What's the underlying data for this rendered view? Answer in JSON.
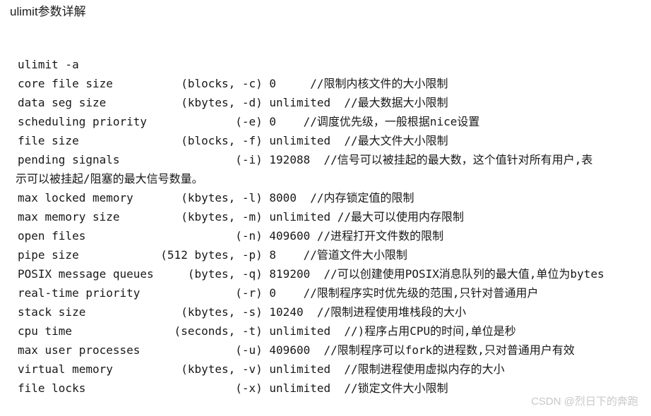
{
  "page": {
    "title": "ulimit参数详解",
    "background_color": "#ffffff",
    "text_color": "#181818"
  },
  "code_block": {
    "command": "ulimit -a",
    "lines": [
      "ulimit -a",
      "core file size          (blocks, -c) 0     //限制内核文件的大小限制",
      "data seg size           (kbytes, -d) unlimited  //最大数据大小限制",
      "scheduling priority             (-e) 0    //调度优先级，一般根据nice设置",
      "file size               (blocks, -f) unlimited  //最大文件大小限制",
      "pending signals                 (-i) 192088  //信号可以被挂起的最大数，这个值针对所有用户,表",
      "示可以被挂起/阻塞的最大信号数量。",
      "max locked memory       (kbytes, -l) 8000  //内存锁定值的限制",
      "max memory size         (kbytes, -m) unlimited //最大可以使用内存限制",
      "open files                      (-n) 409600 //进程打开文件数的限制",
      "pipe size            (512 bytes, -p) 8    //管道文件大小限制",
      "POSIX message queues     (bytes, -q) 819200  //可以创建使用POSIX消息队列的最大值,单位为bytes",
      "real-time priority              (-r) 0    //限制程序实时优先级的范围,只针对普通用户",
      "stack size              (kbytes, -s) 10240  //限制进程使用堆栈段的大小",
      "cpu time               (seconds, -t) unlimited  //)程序占用CPU的时间,单位是秒",
      "max user processes              (-u) 409600  //限制程序可以fork的进程数,只对普通用户有效",
      "virtual memory          (kbytes, -v) unlimited  //限制进程使用虚拟内存的大小",
      "file locks                      (-x) unlimited  //锁定文件大小限制"
    ],
    "wrapped_line_indexes": [
      6
    ],
    "entries": [
      {
        "name": "core file size",
        "unit": "blocks",
        "flag": "-c",
        "value": "0",
        "comment": "//限制内核文件的大小限制"
      },
      {
        "name": "data seg size",
        "unit": "kbytes",
        "flag": "-d",
        "value": "unlimited",
        "comment": "//最大数据大小限制"
      },
      {
        "name": "scheduling priority",
        "unit": "",
        "flag": "-e",
        "value": "0",
        "comment": "//调度优先级，一般根据nice设置"
      },
      {
        "name": "file size",
        "unit": "blocks",
        "flag": "-f",
        "value": "unlimited",
        "comment": "//最大文件大小限制"
      },
      {
        "name": "pending signals",
        "unit": "",
        "flag": "-i",
        "value": "192088",
        "comment": "//信号可以被挂起的最大数，这个值针对所有用户,表示可以被挂起/阻塞的最大信号数量。"
      },
      {
        "name": "max locked memory",
        "unit": "kbytes",
        "flag": "-l",
        "value": "8000",
        "comment": "//内存锁定值的限制"
      },
      {
        "name": "max memory size",
        "unit": "kbytes",
        "flag": "-m",
        "value": "unlimited",
        "comment": "//最大可以使用内存限制"
      },
      {
        "name": "open files",
        "unit": "",
        "flag": "-n",
        "value": "409600",
        "comment": "//进程打开文件数的限制"
      },
      {
        "name": "pipe size",
        "unit": "512 bytes",
        "flag": "-p",
        "value": "8",
        "comment": "//管道文件大小限制"
      },
      {
        "name": "POSIX message queues",
        "unit": "bytes",
        "flag": "-q",
        "value": "819200",
        "comment": "//可以创建使用POSIX消息队列的最大值,单位为bytes"
      },
      {
        "name": "real-time priority",
        "unit": "",
        "flag": "-r",
        "value": "0",
        "comment": "//限制程序实时优先级的范围,只针对普通用户"
      },
      {
        "name": "stack size",
        "unit": "kbytes",
        "flag": "-s",
        "value": "10240",
        "comment": "//限制进程使用堆栈段的大小"
      },
      {
        "name": "cpu time",
        "unit": "seconds",
        "flag": "-t",
        "value": "unlimited",
        "comment": "//)程序占用CPU的时间,单位是秒"
      },
      {
        "name": "max user processes",
        "unit": "",
        "flag": "-u",
        "value": "409600",
        "comment": "//限制程序可以fork的进程数,只对普通用户有效"
      },
      {
        "name": "virtual memory",
        "unit": "kbytes",
        "flag": "-v",
        "value": "unlimited",
        "comment": "//限制进程使用虚拟内存的大小"
      },
      {
        "name": "file locks",
        "unit": "",
        "flag": "-x",
        "value": "unlimited",
        "comment": "//锁定文件大小限制"
      }
    ]
  },
  "watermark": {
    "text": "CSDN @烈日下的奔跑",
    "color": "#c8c8c8"
  }
}
